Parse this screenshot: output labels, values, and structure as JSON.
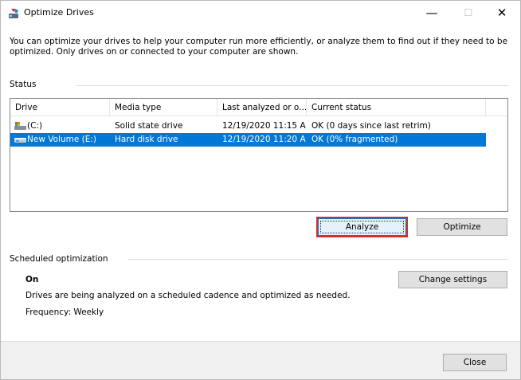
{
  "window": {
    "title": "Optimize Drives",
    "minimize_glyph": "—",
    "maximize_glyph": "☐",
    "close_glyph": "✕",
    "app_icon": "optimize-drives-icon"
  },
  "intro": {
    "line1": "You can optimize your drives to help your computer run more efficiently, or analyze them to find out if they need to be",
    "line2": "optimized. Only drives on or connected to your computer are shown."
  },
  "status": {
    "label": "Status",
    "columns": [
      "Drive",
      "Media type",
      "Last analyzed or o...",
      "Current status"
    ],
    "rows": [
      {
        "drive": "(C:)",
        "media_type": "Solid state drive",
        "last_analyzed": "12/19/2020 11:15 A...",
        "current_status": "OK (0 days since last retrim)",
        "icon": "system-drive-icon",
        "selected": false
      },
      {
        "drive": "New Volume (E:)",
        "media_type": "Hard disk drive",
        "last_analyzed": "12/19/2020 11:20 A...",
        "current_status": "OK (0% fragmented)",
        "icon": "hard-drive-icon",
        "selected": true
      }
    ]
  },
  "actions": {
    "analyze_label": "Analyze",
    "optimize_label": "Optimize"
  },
  "scheduled": {
    "label": "Scheduled optimization",
    "state": "On",
    "description": "Drives are being analyzed on a scheduled cadence and optimized as needed.",
    "frequency": "Frequency: Weekly",
    "change_settings_label": "Change settings"
  },
  "footer": {
    "close_label": "Close"
  },
  "colors": {
    "selection": "#0078d7",
    "focus_highlight": "#d32f2f",
    "button_face": "#e1e1e1"
  }
}
